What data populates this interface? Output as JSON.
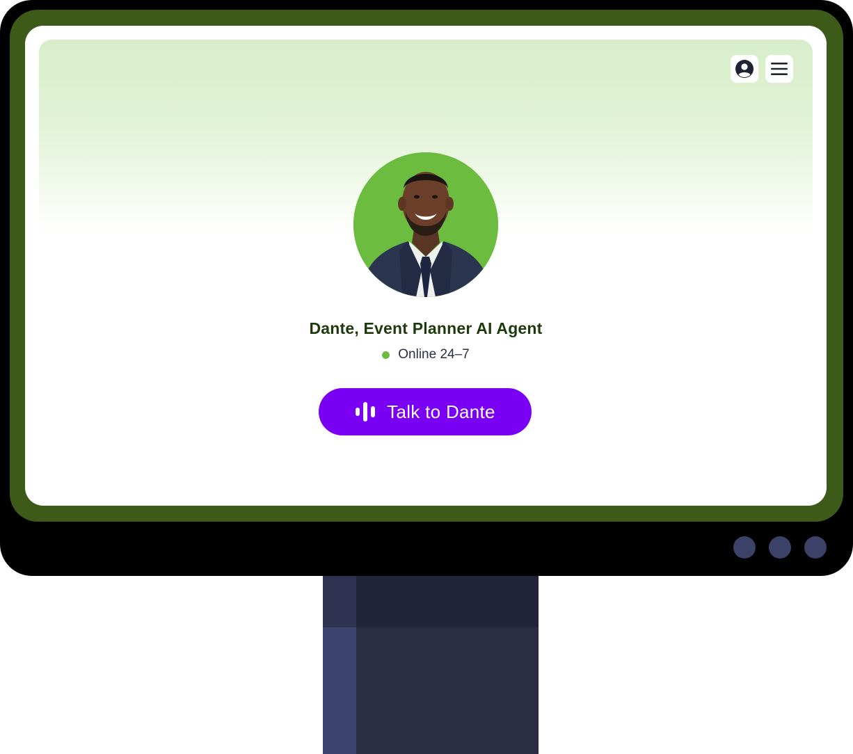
{
  "agent": {
    "name": "Dante, Event Planner AI Agent",
    "status": "Online 24–7"
  },
  "actions": {
    "talk_label": "Talk to Dante"
  },
  "icons": {
    "profile": "user-circle-icon",
    "menu": "hamburger-menu-icon",
    "talk": "audio-bars-icon"
  },
  "colors": {
    "brand_purple": "#7a00f5",
    "accent_green": "#6cbc40",
    "bezel_green": "#3d5a18",
    "name_text": "#1c3a0c"
  }
}
